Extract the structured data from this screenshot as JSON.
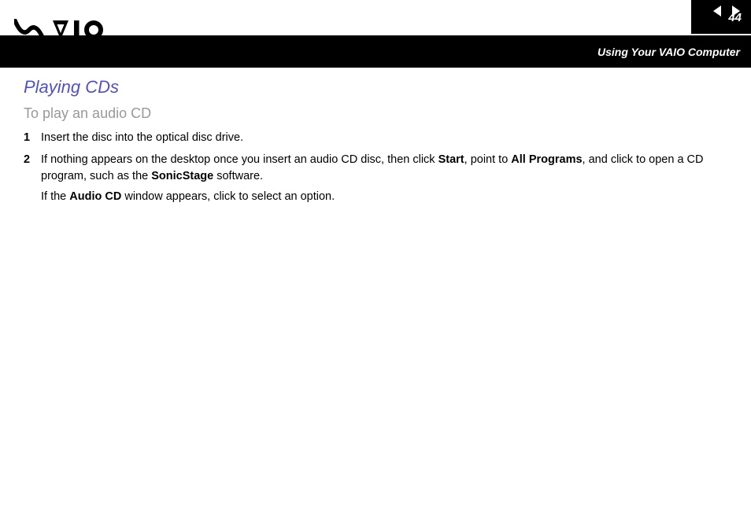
{
  "header": {
    "page_number": "44",
    "breadcrumb": "Using Your VAIO Computer"
  },
  "content": {
    "section_title": "Playing CDs",
    "subsection_title": "To play an audio CD",
    "steps": [
      {
        "num": "1",
        "text": "Insert the disc into the optical disc drive."
      },
      {
        "num": "2",
        "text_pre": "If nothing appears on the desktop once you insert an audio CD disc, then click ",
        "bold1": "Start",
        "text_mid1": ", point to ",
        "bold2": "All Programs",
        "text_mid2": ", and click to open a CD program, such as the ",
        "bold3": "SonicStage",
        "text_post": " software.",
        "extra_pre": "If the ",
        "extra_bold": "Audio CD",
        "extra_post": " window appears, click to select an option."
      }
    ]
  }
}
